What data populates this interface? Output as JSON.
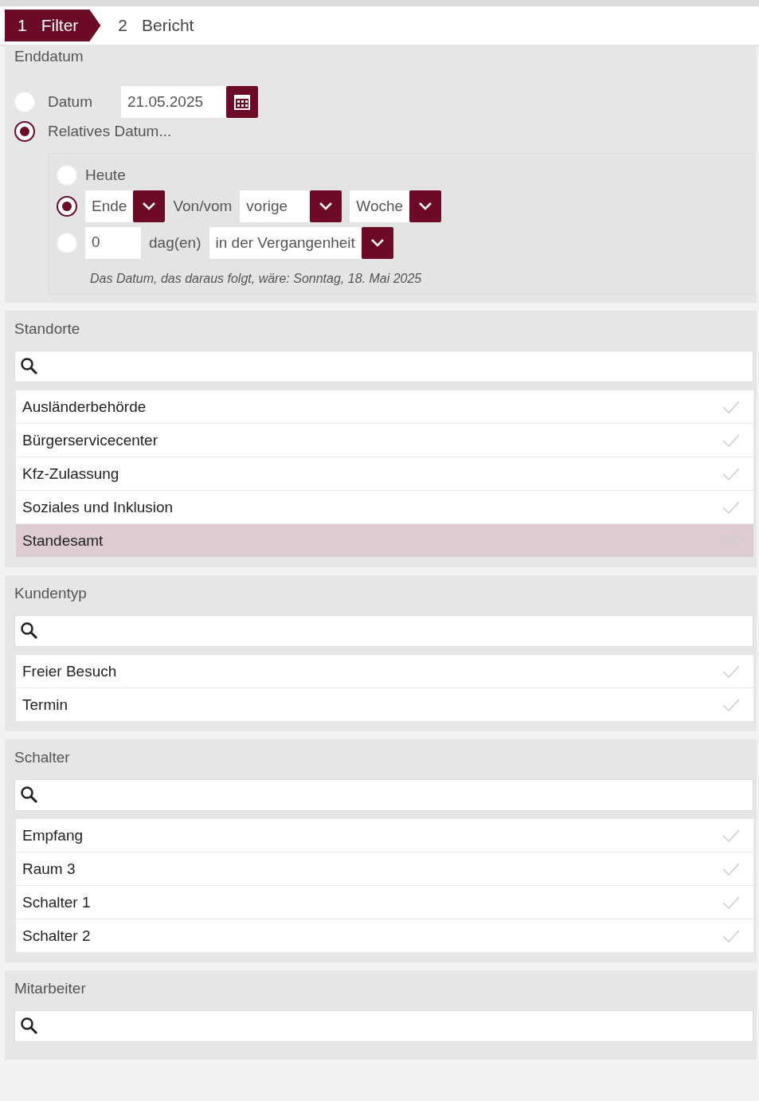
{
  "steps": [
    {
      "number": "1",
      "label": "Filter",
      "selected": true
    },
    {
      "number": "2",
      "label": "Bericht",
      "selected": false
    }
  ],
  "end_date": {
    "title": "Enddatum",
    "absolute": {
      "label": "Datum",
      "selected": false,
      "value": "21.05.2025"
    },
    "relative": {
      "label": "Relatives Datum...",
      "selected": true,
      "options": [
        {
          "kind": "plain",
          "label": "Heute",
          "selected": false
        },
        {
          "kind": "period",
          "selected": true,
          "anchor": "Ende",
          "connector": "Von/vom",
          "modifier": "vorige",
          "unit": "Woche"
        },
        {
          "kind": "offset",
          "selected": false,
          "value": "0",
          "unit": "dag(en)",
          "direction": "in der Vergangenheit"
        }
      ],
      "result": "Das Datum, das daraus folgt, wäre: Sonntag, 18. Mai 2025"
    }
  },
  "filters": [
    {
      "title": "Standorte",
      "items": [
        {
          "label": "Ausländerbehörde",
          "selected": false
        },
        {
          "label": "Bürgerservicecenter",
          "selected": false
        },
        {
          "label": "Kfz-Zulassung",
          "selected": false
        },
        {
          "label": "Soziales und Inklusion",
          "selected": false
        },
        {
          "label": "Standesamt",
          "selected": true
        }
      ]
    },
    {
      "title": "Kundentyp",
      "items": [
        {
          "label": "Freier Besuch",
          "selected": false
        },
        {
          "label": "Termin",
          "selected": false
        }
      ]
    },
    {
      "title": "Schalter",
      "items": [
        {
          "label": "Empfang",
          "selected": false
        },
        {
          "label": "Raum 3",
          "selected": false
        },
        {
          "label": "Schalter 1",
          "selected": false
        },
        {
          "label": "Schalter 2",
          "selected": false
        }
      ]
    },
    {
      "title": "Mitarbeiter"
    }
  ]
}
